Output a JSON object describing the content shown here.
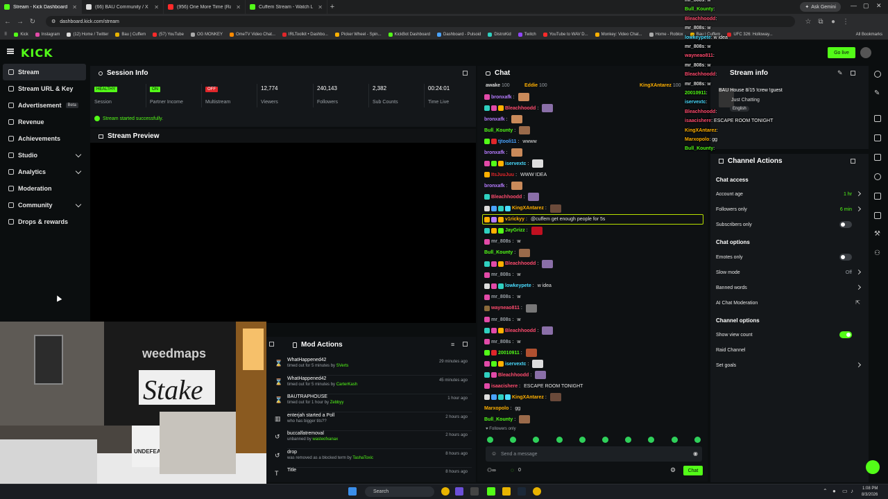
{
  "browser": {
    "tabs": [
      {
        "title": "Stream - Kick Dashboard",
        "color": "#53fc18",
        "active": true
      },
      {
        "title": "(66) BAU Community / X",
        "color": "#dddddd",
        "active": false
      },
      {
        "title": "(956) One More Time (Radio Ed",
        "color": "#ff2a2a",
        "active": false
      },
      {
        "title": "Cuffem Stream - Watch Live on",
        "color": "#53fc18",
        "active": false
      }
    ],
    "gemini_label": "Ask Gemini",
    "url": "dashboard.kick.com/stream",
    "bookmarks": [
      "Kick",
      "Instagram",
      "(12) Home / Twitter",
      "Bau | Cuffem",
      "(57) YouTube",
      "OG MONKEY",
      "OmeTV Video Chat...",
      "IRLToolkit • Dashbo...",
      "Picker Wheel - Spin...",
      "KickBot Dashboard",
      "Dashboard - Pulsoid",
      "DistroKid",
      "Twitch",
      "YouTube to WAV D...",
      "Monkey: Video Chat...",
      "Home - Roblox",
      "Bau | Cuffem",
      "UFC 326: Holloway..."
    ],
    "all_bookmarks": "All Bookmarks"
  },
  "kick": {
    "logo": "KICK",
    "go_live": "Go live"
  },
  "sidebar": {
    "items": [
      {
        "label": "Stream",
        "active": true,
        "expand": false
      },
      {
        "label": "Stream URL & Key",
        "active": false,
        "expand": false
      },
      {
        "label": "Advertisement",
        "badge": "Beta",
        "active": false,
        "expand": false
      },
      {
        "label": "Revenue",
        "active": false,
        "expand": false
      },
      {
        "label": "Achievements",
        "active": false,
        "expand": false
      },
      {
        "label": "Studio",
        "active": false,
        "expand": true
      },
      {
        "label": "Analytics",
        "active": false,
        "expand": true
      },
      {
        "label": "Moderation",
        "active": false,
        "expand": false
      },
      {
        "label": "Community",
        "active": false,
        "expand": true
      },
      {
        "label": "Drops & rewards",
        "active": false,
        "expand": false
      }
    ]
  },
  "session": {
    "title": "Session Info",
    "stats": [
      {
        "value": "HEALTHY",
        "label": "Session",
        "pill": "#53fc18",
        "pilltext": "#0b0e0f"
      },
      {
        "value": "ON",
        "label": "Partner Income",
        "pill": "#53fc18",
        "pilltext": "#0b0e0f"
      },
      {
        "value": "OFF",
        "label": "Multistream",
        "pill": "#e0262a",
        "pilltext": "#ffffff"
      },
      {
        "value": "12,774",
        "label": "Viewers"
      },
      {
        "value": "240,143",
        "label": "Followers"
      },
      {
        "value": "2,382",
        "label": "Sub Counts"
      },
      {
        "value": "00:24:01",
        "label": "Time Live"
      }
    ],
    "success": "Stream started successfully."
  },
  "preview": {
    "title": "Stream Preview"
  },
  "webcam": {
    "brand1": "weedmaps",
    "brand2": "Stake",
    "bag": "UNDEFEATED"
  },
  "clip_ago": [
    "s ago",
    "s ago",
    "s ago",
    "s ago",
    "s ago",
    "s ago",
    "s ago"
  ],
  "mod": {
    "title": "Mod Actions",
    "rows": [
      {
        "icon": "hourglass-icon",
        "glyph": "⌛",
        "who": "WhatHappened42",
        "what": "timed out for 5 minutes by",
        "by": "SVerts",
        "time": "29 minutes ago"
      },
      {
        "icon": "hourglass-icon",
        "glyph": "⌛",
        "who": "WhatHappened42",
        "what": "timed out for 5 minutes by",
        "by": "CarterKash",
        "time": "45 minutes ago"
      },
      {
        "icon": "hourglass-icon",
        "glyph": "⌛",
        "who": "BAUTRAPHOUSE",
        "what": "timed out for 1 hour by",
        "by": "Zebbyy",
        "time": "1 hour ago"
      },
      {
        "icon": "poll-icon",
        "glyph": "▥",
        "who": "enterjah started a Poll",
        "what": "who has bigger tits??",
        "by": "",
        "time": "2 hours ago"
      },
      {
        "icon": "undo-icon",
        "glyph": "↺",
        "who": "buccalfatremoval",
        "what": "unbanned by",
        "by": "wasteofxanax",
        "time": "2 hours ago"
      },
      {
        "icon": "undo-icon",
        "glyph": "↺",
        "who": "drop",
        "what": "was removed as a blocked term by",
        "by": "TashaToxic",
        "time": "8 hours ago"
      },
      {
        "icon": "title-icon",
        "glyph": "T",
        "who": "Title",
        "what": "",
        "by": "",
        "time": "8 hours ago"
      }
    ]
  },
  "chat": {
    "title": "Chat",
    "pinned": [
      {
        "name": "awake",
        "count": "100"
      },
      {
        "name": "Eddie",
        "count": "100"
      },
      {
        "name": "KingXAntarez",
        "count": "100"
      }
    ],
    "lines": [
      {
        "user": "bronxafk",
        "color": "#b67cff",
        "msg": "",
        "emote": "#c98a5a",
        "badges": [
          "#e24aa8"
        ]
      },
      {
        "user": "Bleachhoodd",
        "color": "#ff4b6e",
        "msg": "",
        "emote": "#8a6fa8",
        "badges": [
          "#2fd0c0",
          "#e24aa8",
          "#ffb000"
        ]
      },
      {
        "user": "bronxafk",
        "color": "#b67cff",
        "msg": "",
        "emote": "#c98a5a",
        "badges": []
      },
      {
        "user": "Bull_Kounty",
        "color": "#53fc18",
        "msg": "",
        "emote": "#9a6a4a",
        "badges": []
      },
      {
        "user": "tjtooli11",
        "color": "#4aa3ff",
        "msg": "wwww",
        "emote": "",
        "badges": [
          "#53fc18",
          "#e0262a"
        ]
      },
      {
        "user": "bronxafk",
        "color": "#b67cff",
        "msg": "",
        "emote": "#c98a5a",
        "badges": []
      },
      {
        "user": "iservextc",
        "color": "#4adcff",
        "msg": "",
        "emote": "#dddddd",
        "badges": [
          "#e24aa8",
          "#53fc18",
          "#ffb000"
        ]
      },
      {
        "user": "ItsJuuJuu",
        "color": "#e0262a",
        "msg": "WWW IDEA",
        "emote": "",
        "badges": [
          "#ffb000"
        ]
      },
      {
        "user": "bronxafk",
        "color": "#b67cff",
        "msg": "",
        "emote": "#c98a5a",
        "badges": []
      },
      {
        "user": "Bleachhoodd",
        "color": "#ff4b6e",
        "msg": "",
        "emote": "#8a6fa8",
        "badges": [
          "#2fd0c0"
        ]
      },
      {
        "user": "KingXAntarez",
        "color": "#ffb000",
        "msg": "",
        "emote": "#6a4a3a",
        "badges": [
          "#dddddd",
          "#4aa3ff",
          "#2fd0c0",
          "#4adcff"
        ]
      },
      {
        "user": "v1rickyy",
        "color": "#ffb000",
        "msg": "@cuffem get enough people for 5s",
        "emote": "",
        "badges": [
          "#ffb000",
          "#b67cff",
          "#ffb000"
        ],
        "highlight": true
      },
      {
        "user": "JayGrizz",
        "color": "#53fc18",
        "msg": "",
        "emote": "#c01020",
        "badges": [
          "#2fd0c0",
          "#ffb000",
          "#53fc18"
        ]
      },
      {
        "user": "mr_808s",
        "color": "#9aa0a6",
        "msg": "w",
        "emote": "",
        "badges": [
          "#e24aa8"
        ]
      },
      {
        "user": "Bull_Kounty",
        "color": "#53fc18",
        "msg": "",
        "emote": "#9a6a4a",
        "badges": []
      },
      {
        "user": "Bleachhoodd",
        "color": "#ff4b6e",
        "msg": "",
        "emote": "#8a6fa8",
        "badges": [
          "#2fd0c0",
          "#e24aa8",
          "#ffb000"
        ]
      },
      {
        "user": "mr_808s",
        "color": "#9aa0a6",
        "msg": "w",
        "emote": "",
        "badges": [
          "#e24aa8"
        ]
      },
      {
        "user": "lowkeypete",
        "color": "#4adcff",
        "msg": "w idea",
        "emote": "",
        "badges": [
          "#dddddd",
          "#e24aa8",
          "#2fd0c0"
        ]
      },
      {
        "user": "mr_808s",
        "color": "#9aa0a6",
        "msg": "w",
        "emote": "",
        "badges": [
          "#e24aa8"
        ]
      },
      {
        "user": "wayneao811",
        "color": "#ff4b6e",
        "msg": "",
        "emote": "#777777",
        "badges": [
          "#8a6a3a"
        ]
      },
      {
        "user": "mr_808s",
        "color": "#9aa0a6",
        "msg": "w",
        "emote": "",
        "badges": [
          "#e24aa8"
        ]
      },
      {
        "user": "Bleachhoodd",
        "color": "#ff4b6e",
        "msg": "",
        "emote": "#8a6fa8",
        "badges": [
          "#2fd0c0",
          "#e24aa8",
          "#ffb000"
        ]
      },
      {
        "user": "mr_808s",
        "color": "#9aa0a6",
        "msg": "w",
        "emote": "",
        "badges": [
          "#e24aa8"
        ]
      },
      {
        "user": "20010911",
        "color": "#53fc18",
        "msg": "",
        "emote": "#b05030",
        "badges": [
          "#53fc18",
          "#e0262a"
        ]
      },
      {
        "user": "iservextc",
        "color": "#4adcff",
        "msg": "",
        "emote": "#dddddd",
        "badges": [
          "#e24aa8",
          "#53fc18",
          "#ffb000"
        ]
      },
      {
        "user": "Bleachhoodd",
        "color": "#ff4b6e",
        "msg": "",
        "emote": "#8a6fa8",
        "badges": [
          "#2fd0c0",
          "#e24aa8"
        ]
      },
      {
        "user": "isaacishere",
        "color": "#ff4b6e",
        "msg": "ESCAPE ROOM TONIGHT",
        "emote": "",
        "badges": [
          "#e24aa8"
        ]
      },
      {
        "user": "KingXAntarez",
        "color": "#ffb000",
        "msg": "",
        "emote": "#6a4a3a",
        "badges": [
          "#dddddd",
          "#4aa3ff",
          "#2fd0c0",
          "#4adcff"
        ]
      },
      {
        "user": "Marxopolo",
        "color": "#ffb000",
        "msg": "gg",
        "emote": "",
        "badges": []
      },
      {
        "user": "Bull_Kounty",
        "color": "#53fc18",
        "msg": "",
        "emote": "#9a6a4a",
        "badges": []
      }
    ],
    "followers_only": "Followers only",
    "input_placeholder": "Send a message",
    "send_label": "Chat",
    "count_a": "0"
  },
  "streaminfo": {
    "title": "Stream info",
    "stream_title": "BAU House 8/15 !crew !guest",
    "category": "Just Chatting",
    "language": "English"
  },
  "actions": {
    "title": "Channel Actions",
    "chat_access": "Chat access",
    "account_age": {
      "label": "Account age",
      "value": "1 hr"
    },
    "followers_only": {
      "label": "Followers only",
      "value": "6 min"
    },
    "subscribers_only": "Subscribers only",
    "chat_options": "Chat options",
    "emotes_only": "Emotes only",
    "slow_mode": {
      "label": "Slow mode",
      "value": "Off"
    },
    "banned_words": "Banned words",
    "ai_moderation": "AI Chat Moderation",
    "channel_options": "Channel options",
    "show_view_count": "Show view count",
    "raid_channel": "Raid Channel",
    "set_goals": "Set goals"
  },
  "overlay": [
    {
      "user": "mr_808s",
      "msg": "w",
      "color": "#dddddd"
    },
    {
      "user": "Bull_Kounty",
      "msg": "",
      "color": "#53fc18"
    },
    {
      "user": "Bleachhoodd",
      "msg": "",
      "color": "#ff4b6e"
    },
    {
      "user": "mr_808s",
      "msg": "w",
      "color": "#dddddd"
    },
    {
      "user": "lowkeypete",
      "msg": "w idea",
      "color": "#4adcff"
    },
    {
      "user": "mr_808s",
      "msg": "w",
      "color": "#dddddd"
    },
    {
      "user": "wayneao811",
      "msg": "",
      "color": "#ff4b6e"
    },
    {
      "user": "mr_808s",
      "msg": "w",
      "color": "#dddddd"
    },
    {
      "user": "Bleachhoodd",
      "msg": "",
      "color": "#ff4b6e"
    },
    {
      "user": "mr_808s",
      "msg": "w",
      "color": "#dddddd"
    },
    {
      "user": "20010911",
      "msg": "",
      "color": "#53fc18"
    },
    {
      "user": "iservextc",
      "msg": "",
      "color": "#4adcff"
    },
    {
      "user": "Bleachhoodd",
      "msg": "",
      "color": "#ff4b6e"
    },
    {
      "user": "isaacishere",
      "msg": "ESCAPE ROOM TONIGHT",
      "color": "#ff4b6e"
    },
    {
      "user": "KingXAntarez",
      "msg": "",
      "color": "#ffb000"
    },
    {
      "user": "Marxopolo",
      "msg": "gg",
      "color": "#ffb000"
    },
    {
      "user": "Bull_Kounty",
      "msg": "",
      "color": "#53fc18"
    }
  ],
  "taskbar": {
    "search": "Search",
    "time": "1:08 PM",
    "date": "8/3/2026"
  },
  "colors": {
    "accent": "#53fc18",
    "bg": "#0b0e0f",
    "panel": "#14171a"
  }
}
